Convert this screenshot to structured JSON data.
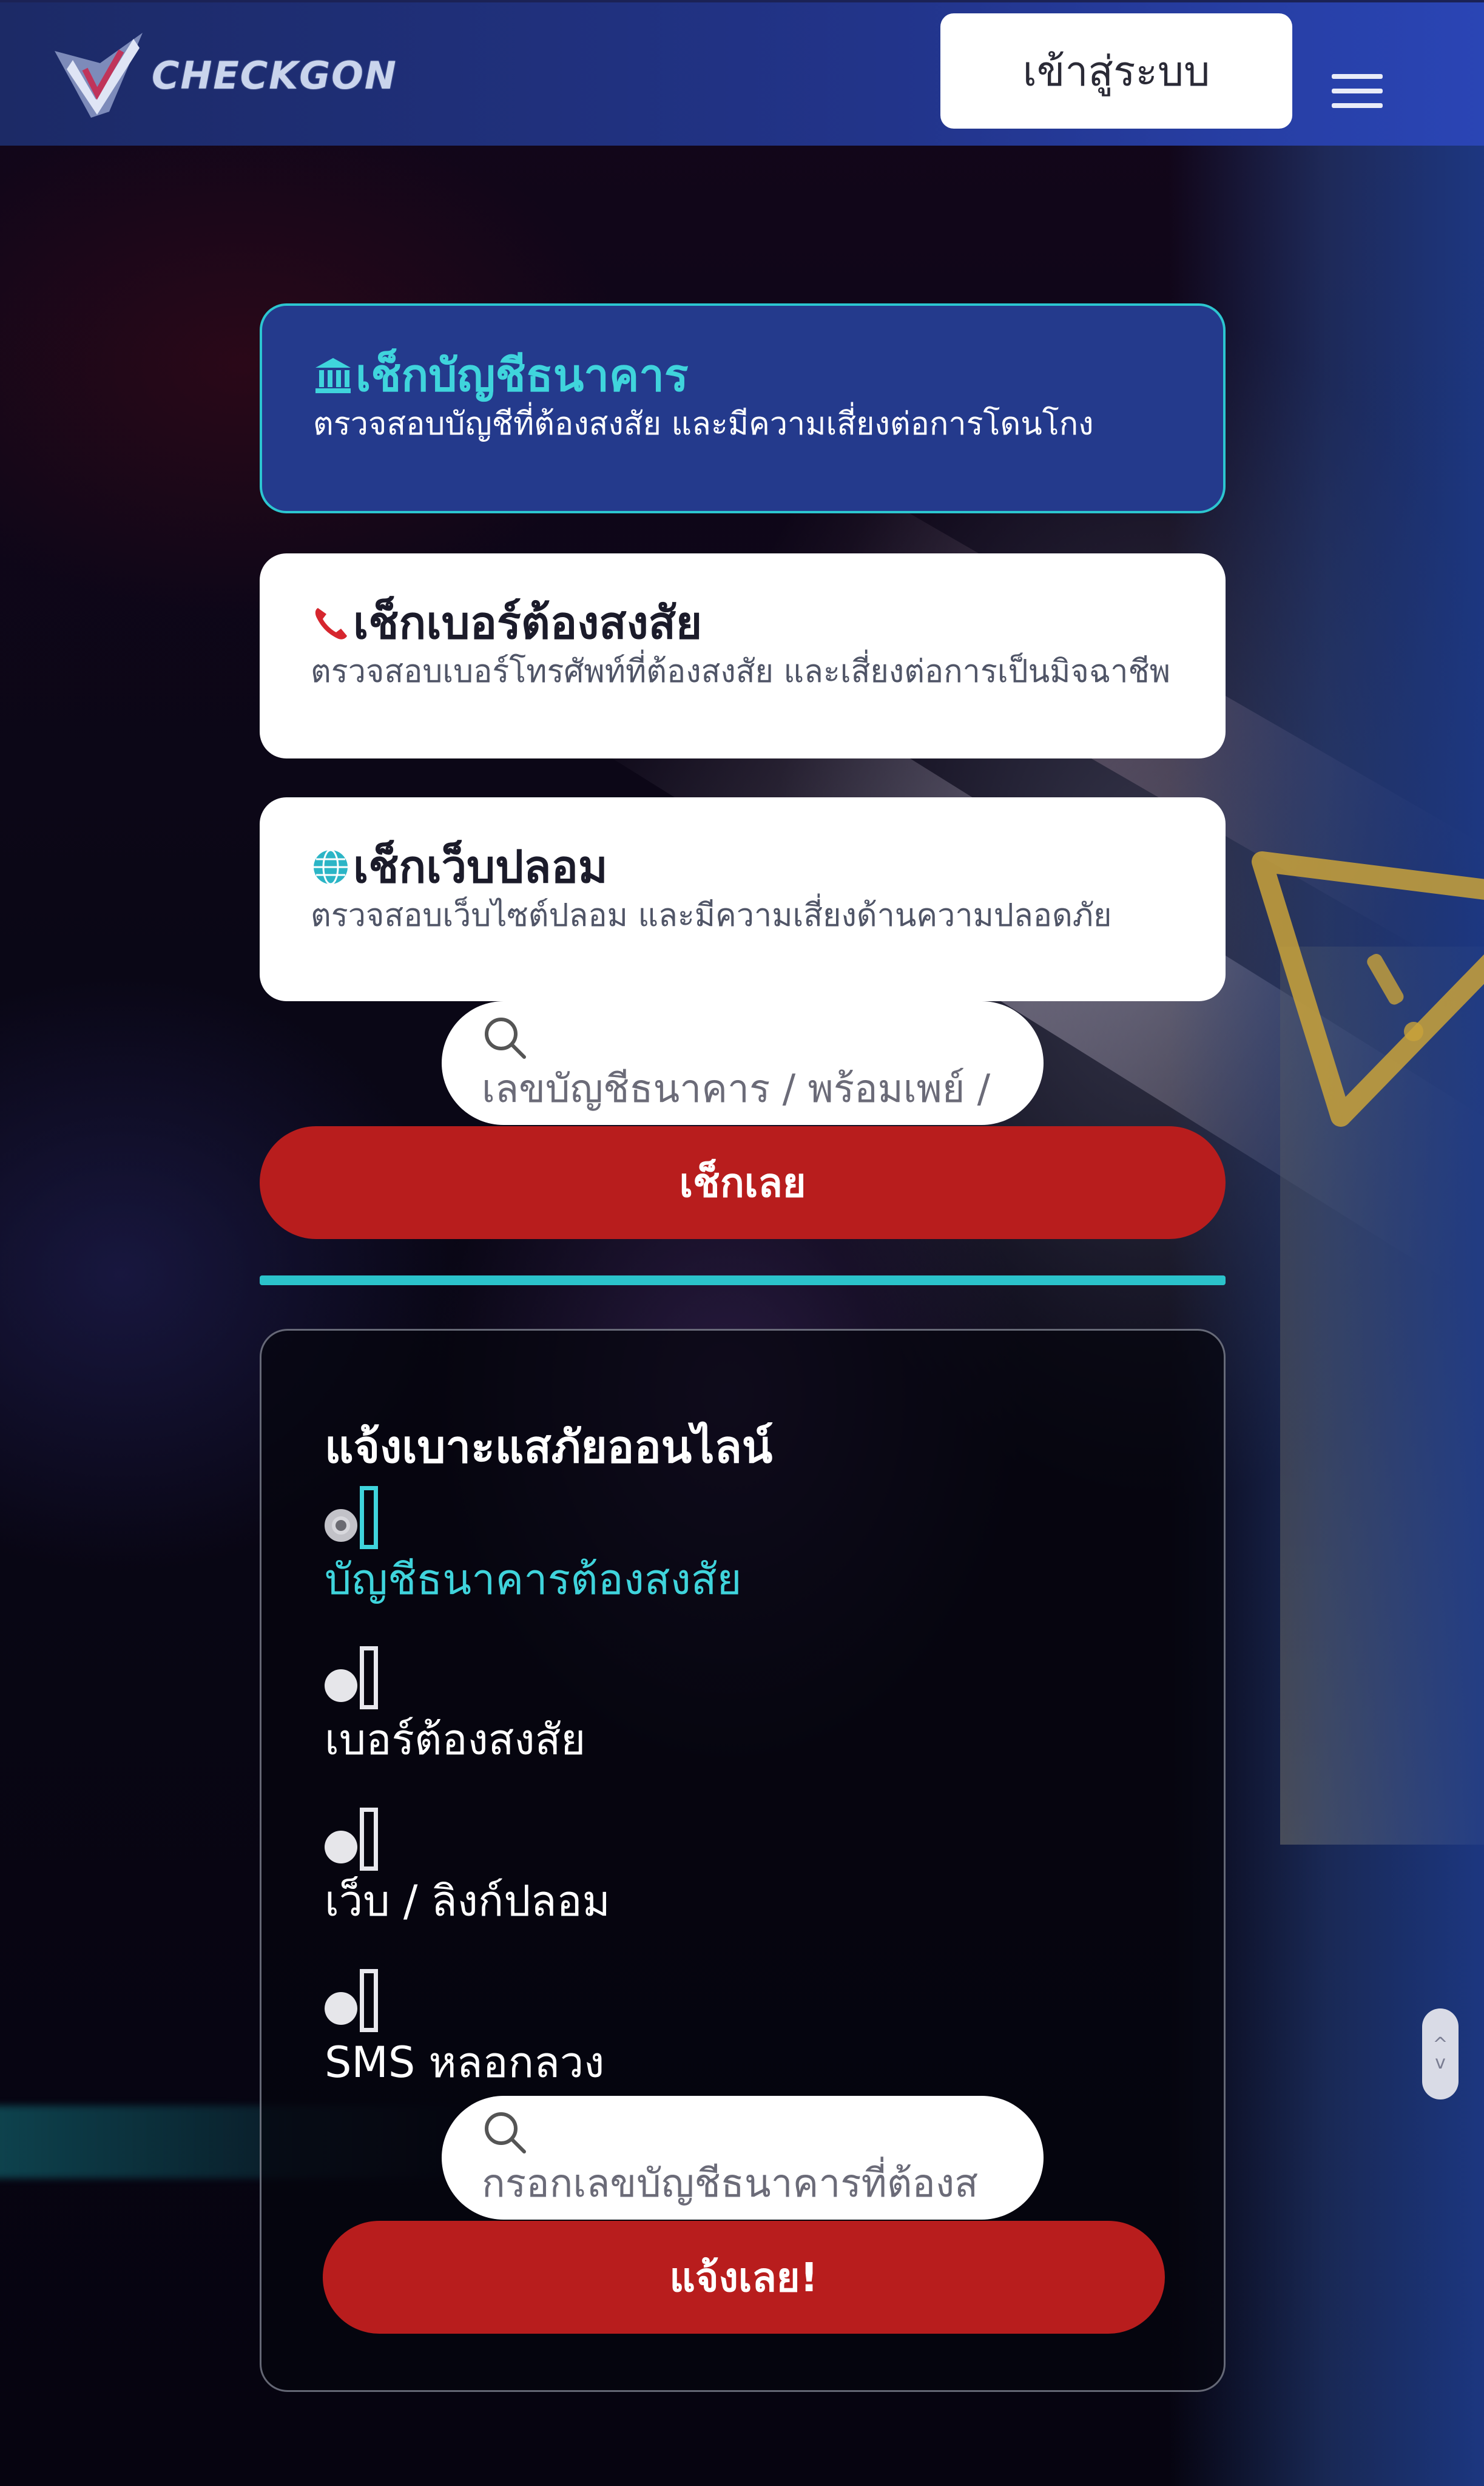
{
  "header": {
    "logo_text": "CHECKGON",
    "login_label": "เข้าสู่ระบบ",
    "menu_icon": "hamburger-icon"
  },
  "checks": [
    {
      "title": "เช็กบัญชีธนาคาร",
      "description": "ตรวจสอบบัญชีที่ต้องสงสัย และมีความเสี่ยงต่อการโดนโกง",
      "icon": "bank-icon",
      "selected": true
    },
    {
      "title": "เช็กเบอร์ต้องสงสัย",
      "description": "ตรวจสอบเบอร์โทรศัพท์ที่ต้องสงสัย และเสี่ยงต่อการเป็นมิจฉาชีพ",
      "icon": "phone-icon",
      "selected": false
    },
    {
      "title": "เช็กเว็บปลอม",
      "description": "ตรวจสอบเว็บไซต์ปลอม และมีความเสี่ยงด้านความปลอดภัย",
      "icon": "globe-icon",
      "selected": false
    }
  ],
  "check_search": {
    "placeholder": "เลขบัญชีธนาคาร / พร้อมเพย์ /",
    "button_label": "เช็กเลย"
  },
  "report": {
    "title": "แจ้งเบาะแสภัยออนไลน์",
    "options": [
      {
        "label": "บัญชีธนาคารต้องสงสัย",
        "selected": true
      },
      {
        "label": "เบอร์ต้องสงสัย",
        "selected": false
      },
      {
        "label": "เว็บ / ลิงก์ปลอม",
        "selected": false
      },
      {
        "label": "SMS หลอกลวง",
        "selected": false
      }
    ],
    "input_placeholder": "กรอกเลขบัญชีธนาคารที่ต้องส",
    "button_label": "แจ้งเลย!"
  },
  "colors": {
    "header_bg": "#22348a",
    "accent_teal": "#2cc6d0",
    "button_red": "#b81d1d",
    "card_selected_bg": "#243a8c"
  }
}
